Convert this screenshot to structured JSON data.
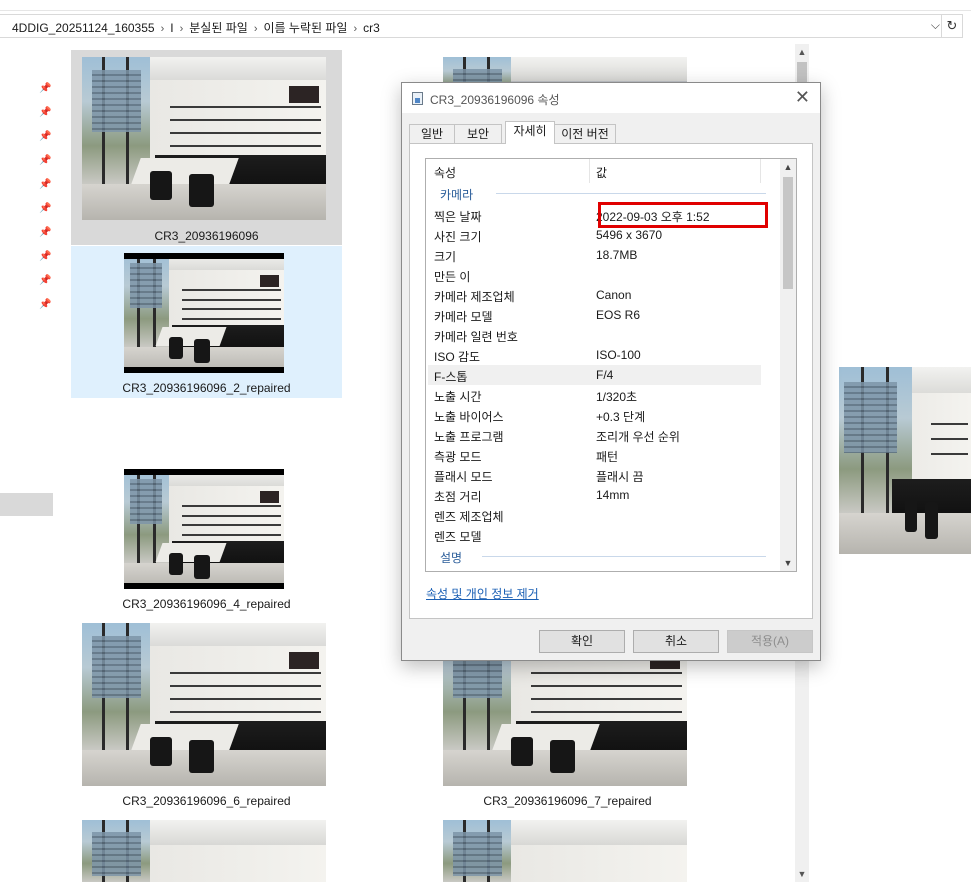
{
  "address_bar": {
    "crumbs": [
      "4DDIG_20251124_160355",
      "I",
      "분실된 파일",
      "이름 누락된 파일",
      "cr3"
    ],
    "dropdown_icon": "chevron-down-icon",
    "refresh_icon": "refresh-icon"
  },
  "files": [
    {
      "name": "CR3_20936196096",
      "state": "selected-inactive"
    },
    {
      "name": "CR3_20936196096_2_repaired",
      "state": "hover"
    },
    {
      "name": "CR3_20936196096_4_repaired",
      "state": "normal"
    },
    {
      "name": "CR3_20936196096_6_repaired",
      "state": "normal"
    },
    {
      "name": "CR3_20936196096_7_repaired",
      "state": "normal"
    }
  ],
  "dialog": {
    "title": "CR3_20936196096 속성",
    "tabs": [
      {
        "label": "일반",
        "active": false
      },
      {
        "label": "보안",
        "active": false
      },
      {
        "label": "자세히",
        "active": true
      },
      {
        "label": "이전 버전",
        "active": false
      }
    ],
    "columns": {
      "property": "속성",
      "value": "값"
    },
    "group_camera": "카메라",
    "group_description": "설명",
    "rows": [
      {
        "key": "찍은 날짜",
        "value": "2022-09-03 오후 1:52"
      },
      {
        "key": "사진 크기",
        "value": "5496 x 3670"
      },
      {
        "key": "크기",
        "value": "18.7MB"
      },
      {
        "key": "만든 이",
        "value": ""
      },
      {
        "key": "카메라 제조업체",
        "value": "Canon"
      },
      {
        "key": "카메라 모델",
        "value": "EOS R6"
      },
      {
        "key": "카메라 일련 번호",
        "value": ""
      },
      {
        "key": "ISO 감도",
        "value": "ISO-100"
      },
      {
        "key": "F-스톱",
        "value": "F/4"
      },
      {
        "key": "노출 시간",
        "value": "1/320초"
      },
      {
        "key": "노출 바이어스",
        "value": "+0.3 단계"
      },
      {
        "key": "노출 프로그램",
        "value": "조리개 우선 순위"
      },
      {
        "key": "측광 모드",
        "value": "패턴"
      },
      {
        "key": "플래시 모드",
        "value": "플래시 끔"
      },
      {
        "key": "초점 거리",
        "value": "14mm"
      },
      {
        "key": "렌즈 제조업체",
        "value": ""
      },
      {
        "key": "렌즈 모델",
        "value": ""
      }
    ],
    "highlighted_row": "F-스톱",
    "annotated_row": "찍은 날짜",
    "remove_link": "속성 및 개인 정보 제거",
    "buttons": {
      "ok": "확인",
      "cancel": "취소",
      "apply": "적용(A)"
    },
    "apply_enabled": false
  },
  "colors": {
    "annotation": "#e00000",
    "link": "#1a5fb4",
    "hover_bg": "#dff0fd",
    "selected_bg": "#d9d9d9"
  }
}
